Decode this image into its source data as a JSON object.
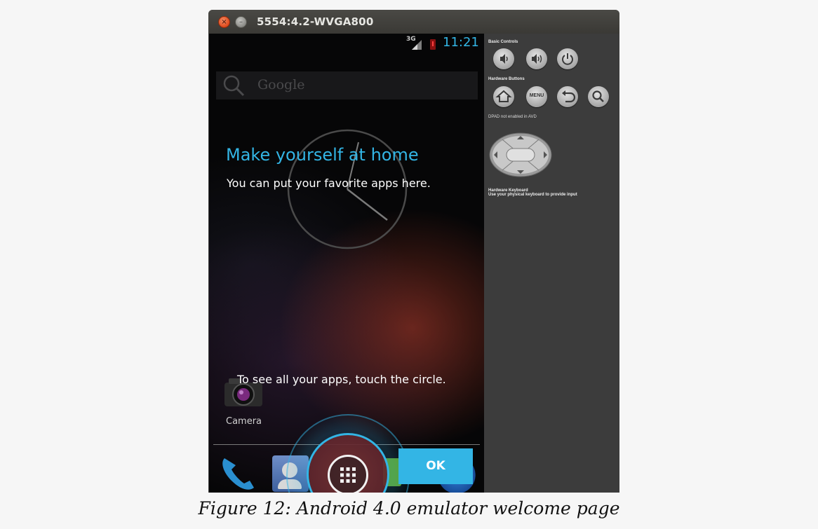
{
  "window": {
    "title": "5554:4.2-WVGA800",
    "close_symbol": "×",
    "minimize_symbol": "–"
  },
  "status_bar": {
    "network": "3G",
    "time": "11:21",
    "icons": [
      "signal-icon",
      "battery-icon"
    ]
  },
  "search": {
    "placeholder": "Google",
    "icon": "search-icon"
  },
  "welcome": {
    "title": "Make yourself at home",
    "subtitle": "You can put your favorite apps here.",
    "hint": "To see all your apps, touch the circle.",
    "ok_label": "OK"
  },
  "home_apps": [
    {
      "label": "Camera",
      "icon": "camera-icon"
    }
  ],
  "dock": {
    "icons": [
      "phone-icon",
      "contacts-icon",
      "all-apps-icon",
      "sms-icon",
      "browser-icon"
    ]
  },
  "controls": {
    "basic_title": "Basic Controls",
    "hardware_title": "Hardware Buttons",
    "menu_label": "MENU",
    "dpad_title": "DPAD not enabled in AVD",
    "keyboard_title": "Hardware Keyboard",
    "keyboard_desc": "Use your physical keyboard to provide input"
  },
  "caption": "Figure 12: Android 4.0 emulator welcome page",
  "colors": {
    "holo_blue": "#33b5e5",
    "panel_bg": "#3c3c3c",
    "titlebar_bg": "#3f3e3a"
  }
}
